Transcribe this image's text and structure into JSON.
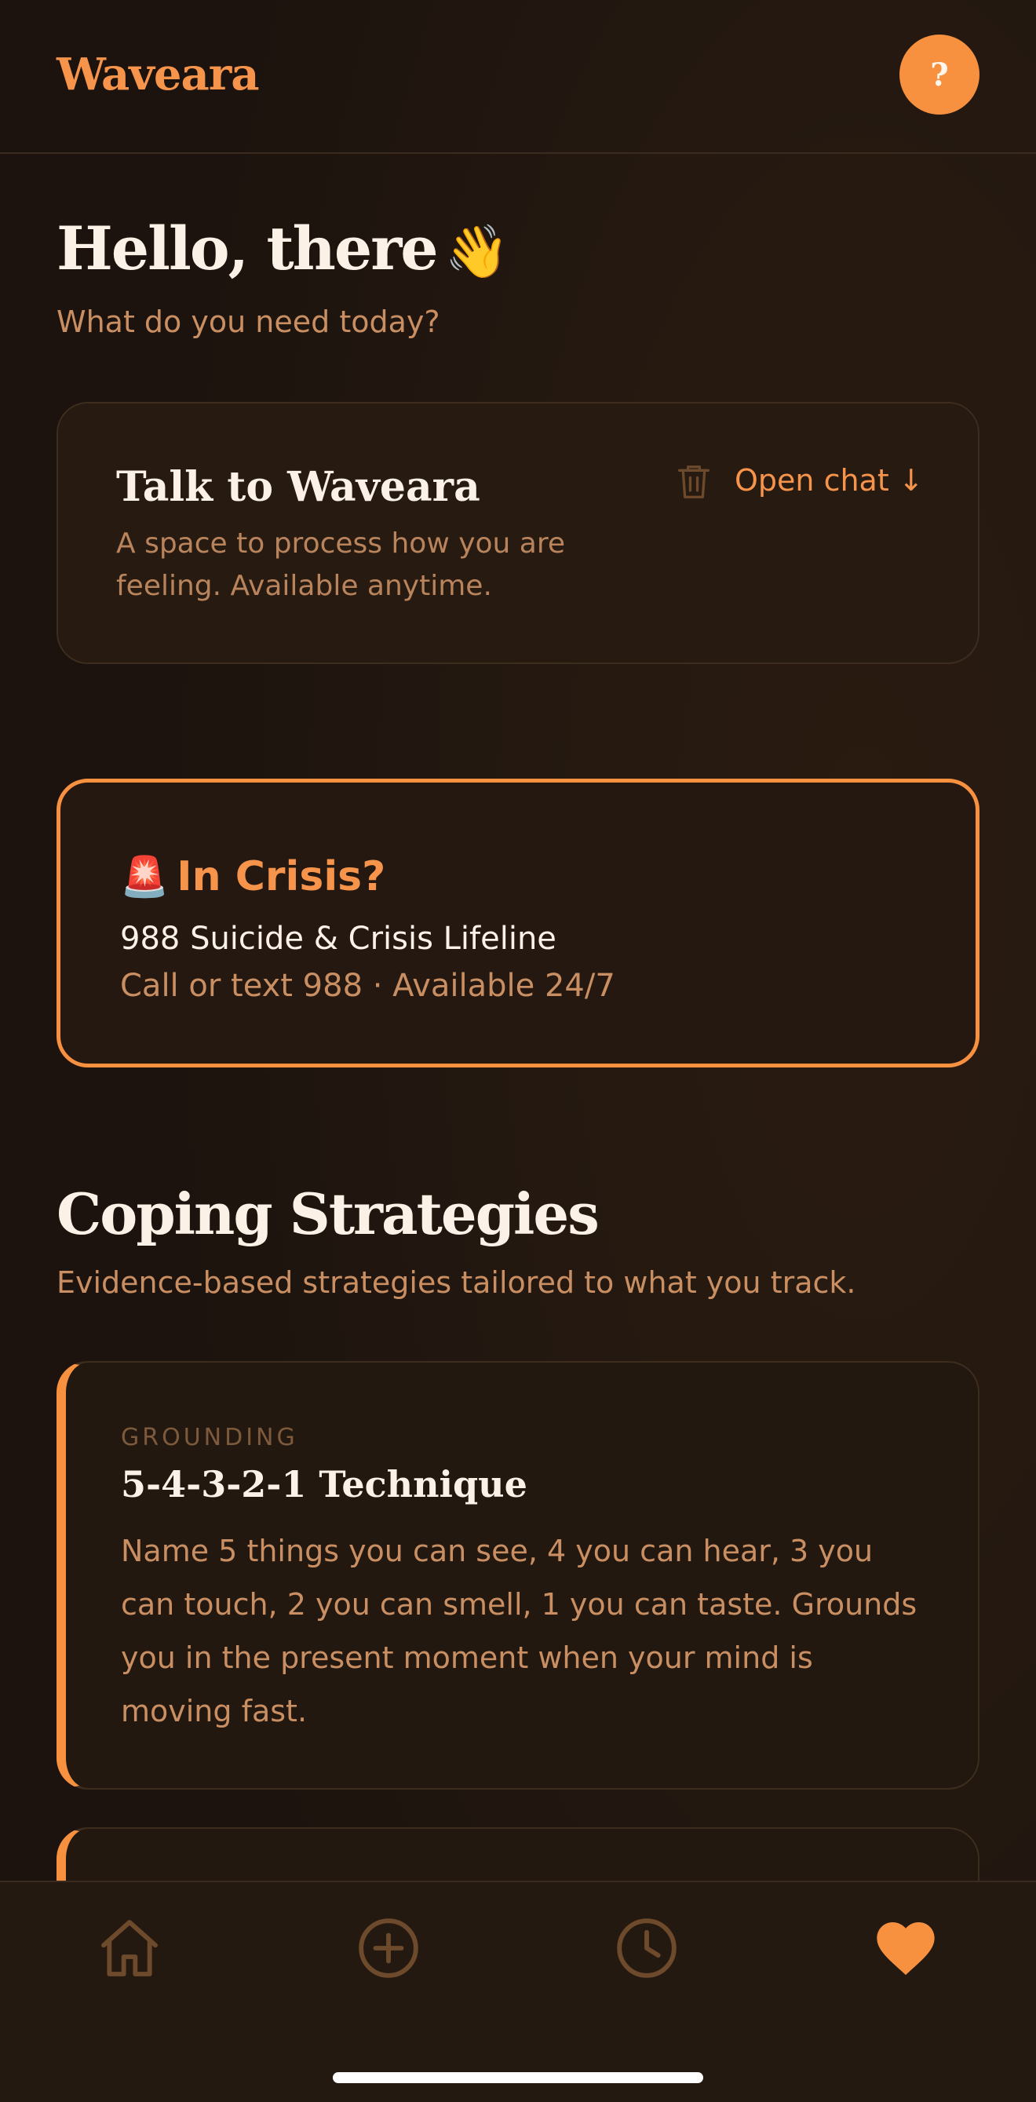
{
  "app": {
    "name": "Waveara",
    "help_label": "?"
  },
  "greeting": {
    "title": "Hello, there",
    "emoji": "👋",
    "subtitle": "What do you need today?"
  },
  "talk_card": {
    "title": "Talk to Waveara",
    "description": "A space to process how you are feeling. Available anytime.",
    "open_chat_label": "Open chat ↓",
    "icons": [
      "trash-icon"
    ]
  },
  "crisis_card": {
    "emoji": "🚨",
    "title": "In Crisis?",
    "line": "988 Suicide & Crisis Lifeline",
    "availability": "Call or text 988 · Available 24/7"
  },
  "coping": {
    "title": "Coping Strategies",
    "subtitle": "Evidence-based strategies tailored to what you track.",
    "strategies": [
      {
        "category": "GROUNDING",
        "title": "5-4-3-2-1 Technique",
        "body": "Name 5 things you can see, 4 you can hear, 3 you can touch, 2 you can smell, 1 you can taste. Grounds you in the present moment when your mind is moving fast."
      }
    ]
  },
  "tabbar": {
    "tabs": [
      {
        "icon": "home-icon",
        "active": false
      },
      {
        "icon": "plus-circle-icon",
        "active": false
      },
      {
        "icon": "clock-icon",
        "active": false
      },
      {
        "icon": "heart-icon",
        "active": true
      }
    ]
  },
  "colors": {
    "accent": "#f7913f",
    "background": "#1e1510",
    "card": "#261a11",
    "text_primary": "#fbf1e6",
    "text_secondary": "#c98f62",
    "muted_icon": "#6e4a2c"
  }
}
